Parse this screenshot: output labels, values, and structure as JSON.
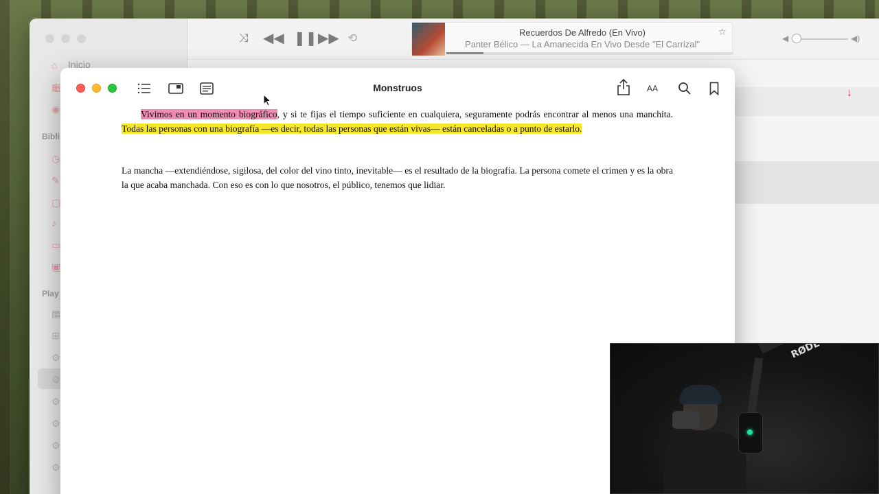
{
  "music": {
    "sidebar": {
      "home_label": "Inicio",
      "library_heading": "Bibli",
      "playlists_heading": "Play"
    },
    "now_playing": {
      "title": "Recuerdos De Alfredo (En Vivo)",
      "subtitle": "Panter Bélico — La Amanecida En Vivo Desde \"El Carrizal\"",
      "progress": 0.13
    },
    "controls": {
      "shuffle": "shuffle-icon",
      "previous": "backward-icon",
      "pause": "pause-icon",
      "next": "forward-icon",
      "repeat": "repeat-icon"
    }
  },
  "books": {
    "title": "Monstruos",
    "font_button_label": "AA",
    "paragraphs": [
      {
        "segments": [
          {
            "text": "Vivimos en un momento biográfico",
            "highlight": "pink"
          },
          {
            "text": ", y si te fijas el tiempo suficiente en cualquiera, seguramente podrás encontrar al menos una manchita. ",
            "highlight": ""
          },
          {
            "text": "Todas las personas con una biografía —es decir, todas las personas que están vivas— están canceladas o a punto de estarlo.",
            "highlight": "yellow"
          }
        ]
      },
      {
        "segments": [
          {
            "text": "La mancha —extendiéndose, sigilosa, del color del vino tinto, inevitable— es el resultado de la biografía. La persona comete el crimen y es la obra la que acaba manchada. Con eso es con lo que nosotros, el público, tenemos que lidiar.",
            "highlight": ""
          }
        ]
      }
    ]
  },
  "colors": {
    "highlight_pink": "#f08cb4",
    "highlight_yellow": "#f7e72a",
    "accent_red": "#e0303a"
  },
  "webcam": {
    "brand": "RØDE"
  }
}
